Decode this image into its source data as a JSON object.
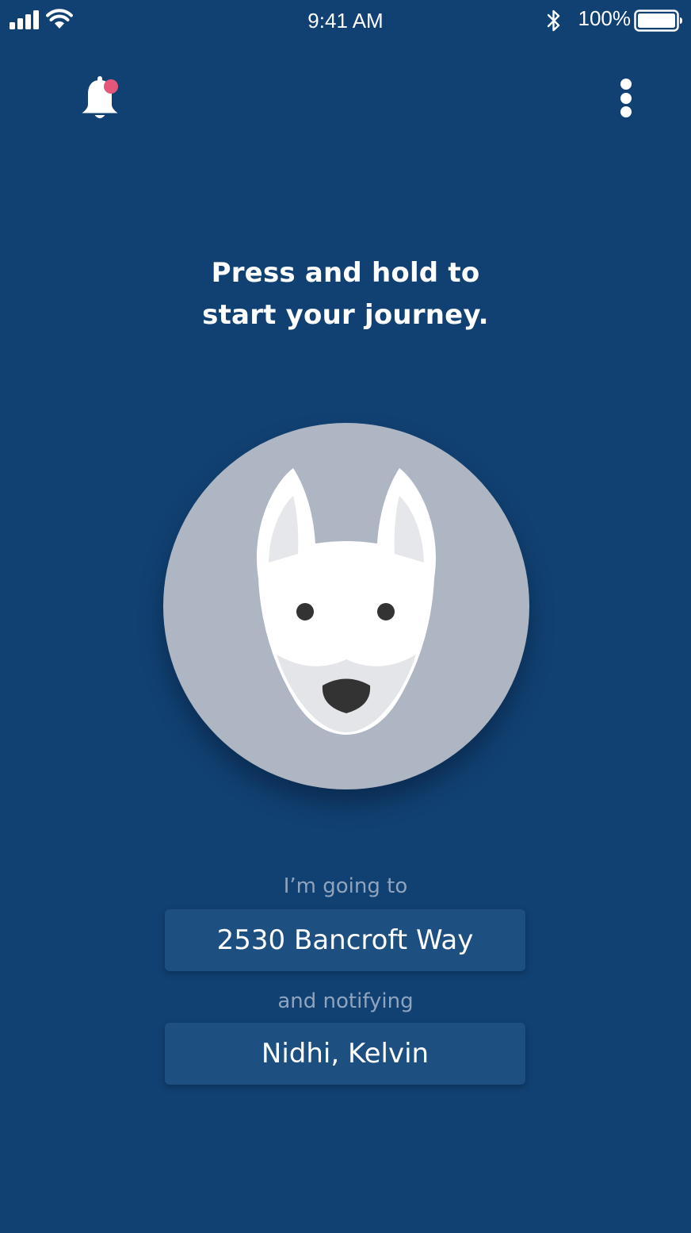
{
  "status_bar": {
    "time": "9:41 AM",
    "battery_percent": "100%",
    "icons": [
      "cellular-signal-icon",
      "wifi-icon",
      "bluetooth-icon",
      "battery-icon"
    ]
  },
  "top_bar": {
    "notifications_icon": "bell-icon",
    "notification_badge": true,
    "menu_icon": "more-vertical-icon"
  },
  "headline": {
    "line1": "Press and hold to",
    "line2": "start your journey."
  },
  "hold_button": {
    "icon": "dog-face-icon"
  },
  "destination": {
    "caption": "I’m going to",
    "value": "2530 Bancroft Way"
  },
  "contacts": {
    "caption": "and notifying",
    "value": "Nidhi, Kelvin"
  },
  "colors": {
    "background": "#114172",
    "circle": "#aeb5c3",
    "field": "#1d4f80",
    "caption": "#8fa4be",
    "badge": "#e5577a",
    "text": "#ffffff"
  }
}
